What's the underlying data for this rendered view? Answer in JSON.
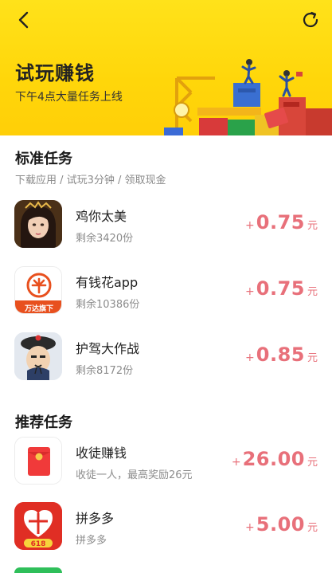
{
  "header": {
    "title": "试玩赚钱",
    "subtitle": "下午4点大量任务上线"
  },
  "standard": {
    "title": "标准任务",
    "steps": "下载应用 / 试玩3分钟 / 领取现金",
    "items": [
      {
        "name": "鸡你太美",
        "remaining": "剩余3420份",
        "plus": "+",
        "amount": "0.75",
        "unit": "元",
        "icon": "game-character-avatar-icon"
      },
      {
        "name": "有钱花app",
        "remaining": "剩余10386份",
        "plus": "+",
        "amount": "0.75",
        "unit": "元",
        "icon": "youqianhua-logo-icon",
        "badge": "万达旗下"
      },
      {
        "name": "护驾大作战",
        "remaining": "剩余8172份",
        "plus": "+",
        "amount": "0.85",
        "unit": "元",
        "icon": "qing-official-avatar-icon"
      }
    ]
  },
  "recommended": {
    "title": "推荐任务",
    "items": [
      {
        "name": "收徒赚钱",
        "desc": "收徒一人，最高奖励26元",
        "plus": "+",
        "amount": "26.00",
        "unit": "元",
        "icon": "red-envelope-icon"
      },
      {
        "name": "拼多多",
        "desc": "拼多多",
        "plus": "+",
        "amount": "5.00",
        "unit": "元",
        "icon": "pinduoduo-logo-icon",
        "badge": "618"
      }
    ]
  },
  "colors": {
    "header_yellow": "#ffd60a",
    "reward_pink": "#e8707a",
    "text_gray": "#8c8c8c"
  }
}
